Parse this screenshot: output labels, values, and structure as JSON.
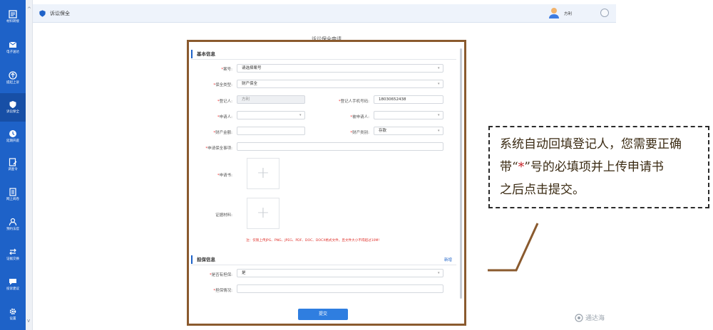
{
  "sidebar": {
    "items": [
      {
        "label": "材料转接",
        "icon": "document-transfer-icon"
      },
      {
        "label": "电子送达",
        "icon": "mail-icon"
      },
      {
        "label": "提起上诉",
        "icon": "upload-icon"
      },
      {
        "label": "诉讼保全",
        "icon": "shield-icon",
        "active": true
      },
      {
        "label": "延期开庭",
        "icon": "clock-icon"
      },
      {
        "label": "调查令",
        "icon": "edit-form-icon"
      },
      {
        "label": "网上阅卷",
        "icon": "file-icon"
      },
      {
        "label": "预约法官",
        "icon": "person-icon"
      },
      {
        "label": "证据交换",
        "icon": "exchange-icon"
      },
      {
        "label": "投诉建议",
        "icon": "chat-icon"
      },
      {
        "label": "设置",
        "icon": "gear-icon"
      }
    ]
  },
  "header": {
    "breadcrumb": "诉讼保全",
    "user_name": "方利"
  },
  "form": {
    "title": "诉讼保全申请",
    "basic_section": "基本信息",
    "case_no_label": "案号:",
    "case_no_placeholder": "请选择案号",
    "preserve_type_label": "保全类型:",
    "preserve_type_value": "财产保全",
    "registrant_label": "登记人:",
    "registrant_value": "方利",
    "registrant_phone_label": "登记人手机号码:",
    "registrant_phone_value": "18030652438",
    "applicant_label": "申请人:",
    "respondent_label": "被申请人:",
    "property_amount_label": "财产金额:",
    "property_type_label": "财产类别:",
    "property_type_value": "存款",
    "matters_label": "申请保全事项:",
    "application_label": "申请书:",
    "evidence_label": "证据材料:",
    "upload_note": "注：仅限上传JPG、PNG、JPEG、PDF、DOC、DOCX格式文件，且文件大小不得超过10M!",
    "guarantee_section": "担保信息",
    "add_label": "新增",
    "has_guarantee_label": "是否有担保:",
    "has_guarantee_value": "是",
    "guarantee_detail_label": "担保情况:",
    "submit_label": "提交"
  },
  "callout": {
    "line1": "系统自动回填登记人，您需要正确",
    "line2_pre": "带“",
    "line2_star": "*",
    "line2_post": "”号的必填项并上传申请书",
    "line3": "之后点击提交。"
  },
  "brand": "通达海",
  "colors": {
    "sidebar": "#1e62c8",
    "frame": "#8a5a2e",
    "required": "#e33333",
    "primary_button": "#2f7ee0"
  }
}
